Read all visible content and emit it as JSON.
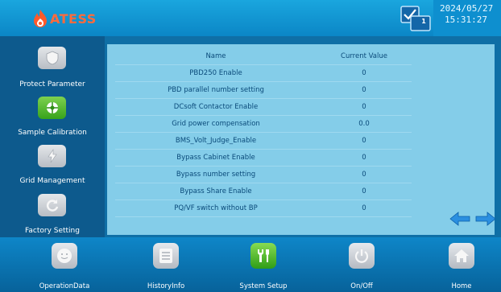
{
  "header": {
    "logo_text": "ATESS",
    "date": "2024/05/27",
    "time": "15:31:27",
    "message_count": "1"
  },
  "sidebar": {
    "items": [
      {
        "label": "Protect Parameter",
        "icon": "shield-icon",
        "active": false
      },
      {
        "label": "Sample Calibration",
        "icon": "target-icon",
        "active": true
      },
      {
        "label": "Grid Management",
        "icon": "lightning-icon",
        "active": false
      },
      {
        "label": "Factory Setting",
        "icon": "refresh-icon",
        "active": false
      }
    ]
  },
  "table": {
    "headers": [
      "Name",
      "Current Value"
    ],
    "rows": [
      {
        "name": "PBD250 Enable",
        "value": "0"
      },
      {
        "name": "PBD parallel number setting",
        "value": "0"
      },
      {
        "name": "DCsoft Contactor Enable",
        "value": "0"
      },
      {
        "name": "Grid power compensation",
        "value": "0.0"
      },
      {
        "name": "BMS_Volt_Judge_Enable",
        "value": "0"
      },
      {
        "name": "Bypass Cabinet Enable",
        "value": "0"
      },
      {
        "name": "Bypass number setting",
        "value": "0"
      },
      {
        "name": "Bypass Share Enable",
        "value": "0"
      },
      {
        "name": "PQ/VF switch without BP",
        "value": "0"
      }
    ]
  },
  "bottom_nav": {
    "items": [
      {
        "label": "OperationData",
        "icon": "face-icon",
        "active": false
      },
      {
        "label": "HistoryInfo",
        "icon": "list-icon",
        "active": false
      },
      {
        "label": "System Setup",
        "icon": "tools-icon",
        "active": true
      },
      {
        "label": "On/Off",
        "icon": "power-icon",
        "active": false
      },
      {
        "label": "Home",
        "icon": "home-icon",
        "active": false
      }
    ]
  },
  "colors": {
    "accent": "#0e86c8",
    "active_green": "#37a31b",
    "panel": "#84cde9",
    "logo": "#ff6a3c"
  }
}
